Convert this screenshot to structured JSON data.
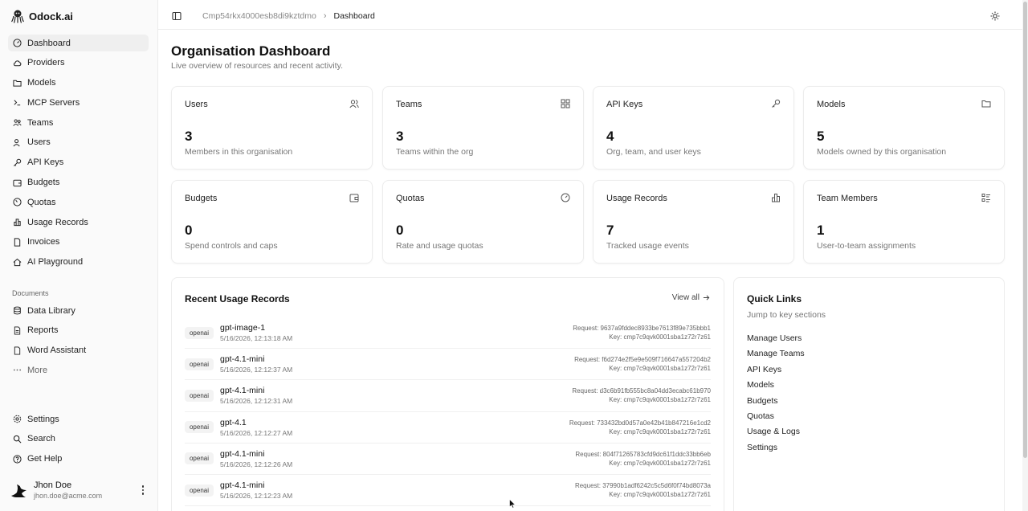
{
  "brand": {
    "name": "Odock.ai"
  },
  "nav": [
    {
      "label": "Dashboard",
      "icon": "gauge-icon",
      "active": true
    },
    {
      "label": "Providers",
      "icon": "cloud-icon"
    },
    {
      "label": "Models",
      "icon": "folder-icon"
    },
    {
      "label": "MCP Servers",
      "icon": "server-icon"
    },
    {
      "label": "Teams",
      "icon": "team-icon"
    },
    {
      "label": "Users",
      "icon": "user-icon"
    },
    {
      "label": "API Keys",
      "icon": "key-icon"
    },
    {
      "label": "Budgets",
      "icon": "wallet-icon"
    },
    {
      "label": "Quotas",
      "icon": "quota-icon"
    },
    {
      "label": "Usage Records",
      "icon": "bar-chart-icon"
    },
    {
      "label": "Invoices",
      "icon": "invoice-icon"
    },
    {
      "label": "AI Playground",
      "icon": "playground-icon"
    }
  ],
  "documents": {
    "label": "Documents",
    "items": [
      {
        "label": "Data Library",
        "icon": "database-icon"
      },
      {
        "label": "Reports",
        "icon": "report-icon"
      },
      {
        "label": "Word Assistant",
        "icon": "word-icon"
      },
      {
        "label": "More",
        "icon": "more-icon"
      }
    ]
  },
  "bottom_nav": [
    {
      "label": "Settings",
      "icon": "gear-icon"
    },
    {
      "label": "Search",
      "icon": "search-icon"
    },
    {
      "label": "Get Help",
      "icon": "help-icon"
    }
  ],
  "user": {
    "name": "Jhon Doe",
    "email": "jhon.doe@acme.com"
  },
  "breadcrumb": {
    "org": "Cmp54rkx4000esb8di9kztdmo",
    "current": "Dashboard"
  },
  "page": {
    "title": "Organisation Dashboard",
    "subtitle": "Live overview of resources and recent activity."
  },
  "cards": [
    {
      "title": "Users",
      "value": "3",
      "desc": "Members in this organisation",
      "icon": "users-icon"
    },
    {
      "title": "Teams",
      "value": "3",
      "desc": "Teams within the org",
      "icon": "grid-icon"
    },
    {
      "title": "API Keys",
      "value": "4",
      "desc": "Org, team, and user keys",
      "icon": "key-icon"
    },
    {
      "title": "Models",
      "value": "5",
      "desc": "Models owned by this organisation",
      "icon": "folder-icon"
    },
    {
      "title": "Budgets",
      "value": "0",
      "desc": "Spend controls and caps",
      "icon": "wallet-icon"
    },
    {
      "title": "Quotas",
      "value": "0",
      "desc": "Rate and usage quotas",
      "icon": "gauge-icon"
    },
    {
      "title": "Usage Records",
      "value": "7",
      "desc": "Tracked usage events",
      "icon": "bar-chart-icon"
    },
    {
      "title": "Team Members",
      "value": "1",
      "desc": "User-to-team assignments",
      "icon": "list-icon"
    }
  ],
  "recent": {
    "title": "Recent Usage Records",
    "view_all": "View all",
    "rows": [
      {
        "provider": "openai",
        "model": "gpt-image-1",
        "time": "5/16/2026, 12:13:18 AM",
        "request": "Request: 9637a9fddec8933be7613f89e735bbb1",
        "key": "Key: cmp7c9qvk0001sba1z72r7z61"
      },
      {
        "provider": "openai",
        "model": "gpt-4.1-mini",
        "time": "5/16/2026, 12:12:37 AM",
        "request": "Request: f6d274e2f5e9e509f716647a557204b2",
        "key": "Key: cmp7c9qvk0001sba1z72r7z61"
      },
      {
        "provider": "openai",
        "model": "gpt-4.1-mini",
        "time": "5/16/2026, 12:12:31 AM",
        "request": "Request: d3c6b91fb555bc8a04dd3ecabc61b970",
        "key": "Key: cmp7c9qvk0001sba1z72r7z61"
      },
      {
        "provider": "openai",
        "model": "gpt-4.1",
        "time": "5/16/2026, 12:12:27 AM",
        "request": "Request: 733432bd0d57a0e42b41b847216e1cd2",
        "key": "Key: cmp7c9qvk0001sba1z72r7z61"
      },
      {
        "provider": "openai",
        "model": "gpt-4.1-mini",
        "time": "5/16/2026, 12:12:26 AM",
        "request": "Request: 804f71265783cfd9dc61f1ddc33bb6eb",
        "key": "Key: cmp7c9qvk0001sba1z72r7z61"
      },
      {
        "provider": "openai",
        "model": "gpt-4.1-mini",
        "time": "5/16/2026, 12:12:23 AM",
        "request": "Request: 37990b1adf6242c5c5d6f0f74bd8073a",
        "key": "Key: cmp7c9qvk0001sba1z72r7z61"
      }
    ]
  },
  "quick_links": {
    "title": "Quick Links",
    "subtitle": "Jump to key sections",
    "items": [
      "Manage Users",
      "Manage Teams",
      "API Keys",
      "Models",
      "Budgets",
      "Quotas",
      "Usage & Logs",
      "Settings"
    ]
  }
}
